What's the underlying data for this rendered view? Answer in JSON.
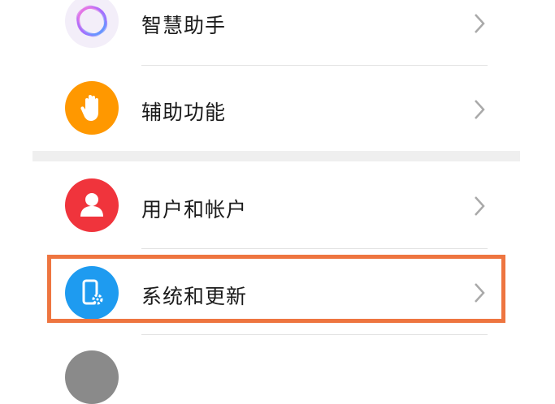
{
  "settings": {
    "items": [
      {
        "label": "智慧助手",
        "icon": "smart-assistant-icon",
        "color": "#c06af2"
      },
      {
        "label": "辅助功能",
        "icon": "hand-accessibility-icon",
        "color": "#ff9800"
      },
      {
        "label": "用户和帐户",
        "icon": "user-account-icon",
        "color": "#f0343c"
      },
      {
        "label": "系统和更新",
        "icon": "system-update-icon",
        "color": "#1e9bf0"
      },
      {
        "label": "",
        "icon": "more-settings-icon",
        "color": "#8a8a8a"
      }
    ],
    "highlight_color": "#ee7540"
  }
}
